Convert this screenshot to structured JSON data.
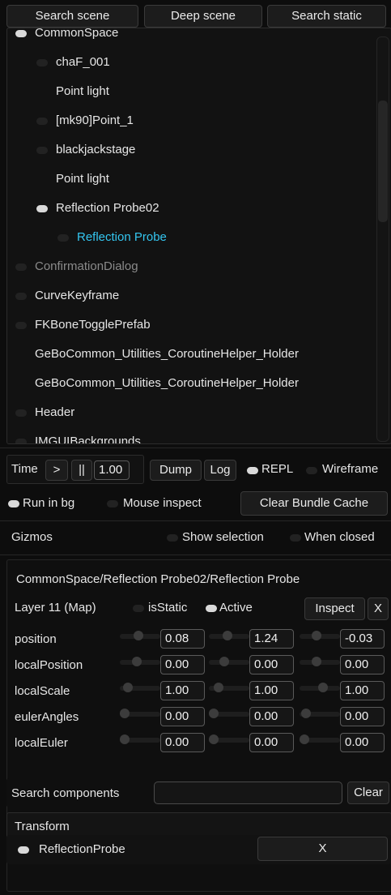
{
  "top_tabs": [
    "Search scene",
    "Deep scene",
    "Search static"
  ],
  "tree": [
    {
      "label": "CommonSpace",
      "indent": 0,
      "toggle": "on",
      "color": "#e6e6e6"
    },
    {
      "label": "chaF_001",
      "indent": 1,
      "toggle": "off",
      "color": "#e6e6e6"
    },
    {
      "label": "Point light",
      "indent": 1,
      "toggle": "none",
      "color": "#e6e6e6"
    },
    {
      "label": "[mk90]Point_1",
      "indent": 1,
      "toggle": "off",
      "color": "#e6e6e6"
    },
    {
      "label": "blackjackstage",
      "indent": 1,
      "toggle": "off",
      "color": "#e6e6e6"
    },
    {
      "label": "Point light",
      "indent": 1,
      "toggle": "none",
      "color": "#e6e6e6"
    },
    {
      "label": "Reflection Probe02",
      "indent": 1,
      "toggle": "on",
      "color": "#e6e6e6"
    },
    {
      "label": "Reflection Probe",
      "indent": 2,
      "toggle": "off",
      "color": "#34c6f0"
    },
    {
      "label": "ConfirmationDialog",
      "indent": 0,
      "toggle": "off",
      "color": "#8a8a8a"
    },
    {
      "label": "CurveKeyframe",
      "indent": 0,
      "toggle": "off",
      "color": "#e6e6e6"
    },
    {
      "label": "FKBoneTogglePrefab",
      "indent": 0,
      "toggle": "off",
      "color": "#e6e6e6"
    },
    {
      "label": "GeBoCommon_Utilities_CoroutineHelper_Holder",
      "indent": 0,
      "toggle": "none",
      "color": "#e6e6e6"
    },
    {
      "label": "GeBoCommon_Utilities_CoroutineHelper_Holder",
      "indent": 0,
      "toggle": "none",
      "color": "#e6e6e6"
    },
    {
      "label": "Header",
      "indent": 0,
      "toggle": "off",
      "color": "#e6e6e6"
    },
    {
      "label": "IMGUIBackgrounds",
      "indent": 0,
      "toggle": "off",
      "color": "#e6e6e6"
    }
  ],
  "time": {
    "label": "Time",
    "play": ">",
    "pause": "||",
    "value": "1.00"
  },
  "tools": {
    "dump": "Dump",
    "log": "Log",
    "repl": "REPL",
    "wireframe": "Wireframe"
  },
  "options": {
    "run_in_bg": "Run in bg",
    "mouse_inspect": "Mouse inspect",
    "clear_cache": "Clear Bundle Cache"
  },
  "gizmos": {
    "label": "Gizmos",
    "show_selection": "Show selection",
    "when_closed": "When closed"
  },
  "inspector": {
    "path": "CommonSpace/Reflection Probe02/Reflection Probe",
    "layer": "Layer 11 (Map)",
    "is_static": "isStatic",
    "active": "Active",
    "inspect": "Inspect",
    "close": "X",
    "transform_rows": [
      {
        "label": "position",
        "values": [
          "0.08",
          "1.24",
          "-0.03"
        ]
      },
      {
        "label": "localPosition",
        "values": [
          "0.00",
          "0.00",
          "0.00"
        ]
      },
      {
        "label": "localScale",
        "values": [
          "1.00",
          "1.00",
          "1.00"
        ]
      },
      {
        "label": "eulerAngles",
        "values": [
          "0.00",
          "0.00",
          "0.00"
        ]
      },
      {
        "label": "localEuler",
        "values": [
          "0.00",
          "0.00",
          "0.00"
        ]
      }
    ]
  },
  "components": {
    "search_label": "Search components",
    "search_value": "",
    "clear": "Clear",
    "transform": "Transform",
    "reflection_probe": "ReflectionProbe",
    "remove": "X"
  }
}
